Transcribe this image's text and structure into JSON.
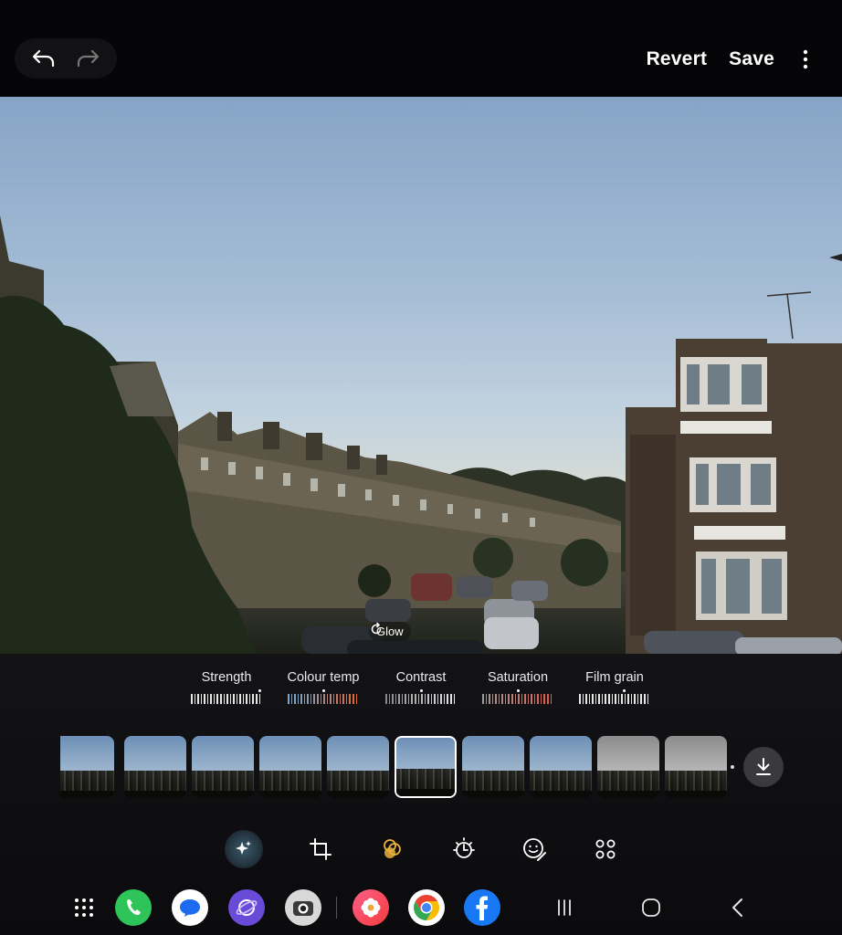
{
  "toolbar": {
    "undo_icon": "undo-arrow-icon",
    "redo_icon": "redo-arrow-icon",
    "revert_label": "Revert",
    "save_label": "Save",
    "more_icon": "more-vertical-icon"
  },
  "photo": {
    "filter_name": "Glow"
  },
  "adjustments": [
    {
      "label": "Strength",
      "colors": [
        "#e6e6e6",
        "#e6e6e6"
      ]
    },
    {
      "label": "Colour temp",
      "colors": [
        "#6fa9d8",
        "#e0693a"
      ]
    },
    {
      "label": "Contrast",
      "colors": [
        "#8a8a8a",
        "#e6e6e6"
      ]
    },
    {
      "label": "Saturation",
      "colors": [
        "#9b9b9b",
        "#e35a4a"
      ]
    },
    {
      "label": "Film grain",
      "colors": [
        "#e6e6e6",
        "#e6e6e6"
      ]
    }
  ],
  "filters": {
    "count": 10,
    "selected_index": 5,
    "bw_indices": [
      8,
      9
    ]
  },
  "tools": [
    {
      "name": "auto-enhance-icon",
      "active": true
    },
    {
      "name": "crop-rotate-icon",
      "active": false
    },
    {
      "name": "filters-icon",
      "active": false
    },
    {
      "name": "brightness-tone-icon",
      "active": false
    },
    {
      "name": "sticker-decorate-icon",
      "active": false
    },
    {
      "name": "more-tools-icon",
      "active": false
    }
  ],
  "taskbar": {
    "apps": [
      {
        "name": "app-drawer-icon",
        "color": "#000000"
      },
      {
        "name": "phone-app-icon",
        "color": "#2fc45a"
      },
      {
        "name": "messages-app-icon",
        "color": "#ffffff"
      },
      {
        "name": "internet-app-icon",
        "color": "#6a4bd8"
      },
      {
        "name": "camera-app-icon",
        "color": "#d8d8d8"
      },
      {
        "name": "gallery-app-icon",
        "color": "#f0485c"
      },
      {
        "name": "chrome-app-icon",
        "color": "#ffffff"
      },
      {
        "name": "facebook-app-icon",
        "color": "#1877f2"
      }
    ],
    "nav": [
      "recents-nav-icon",
      "home-nav-icon",
      "back-nav-icon"
    ]
  }
}
